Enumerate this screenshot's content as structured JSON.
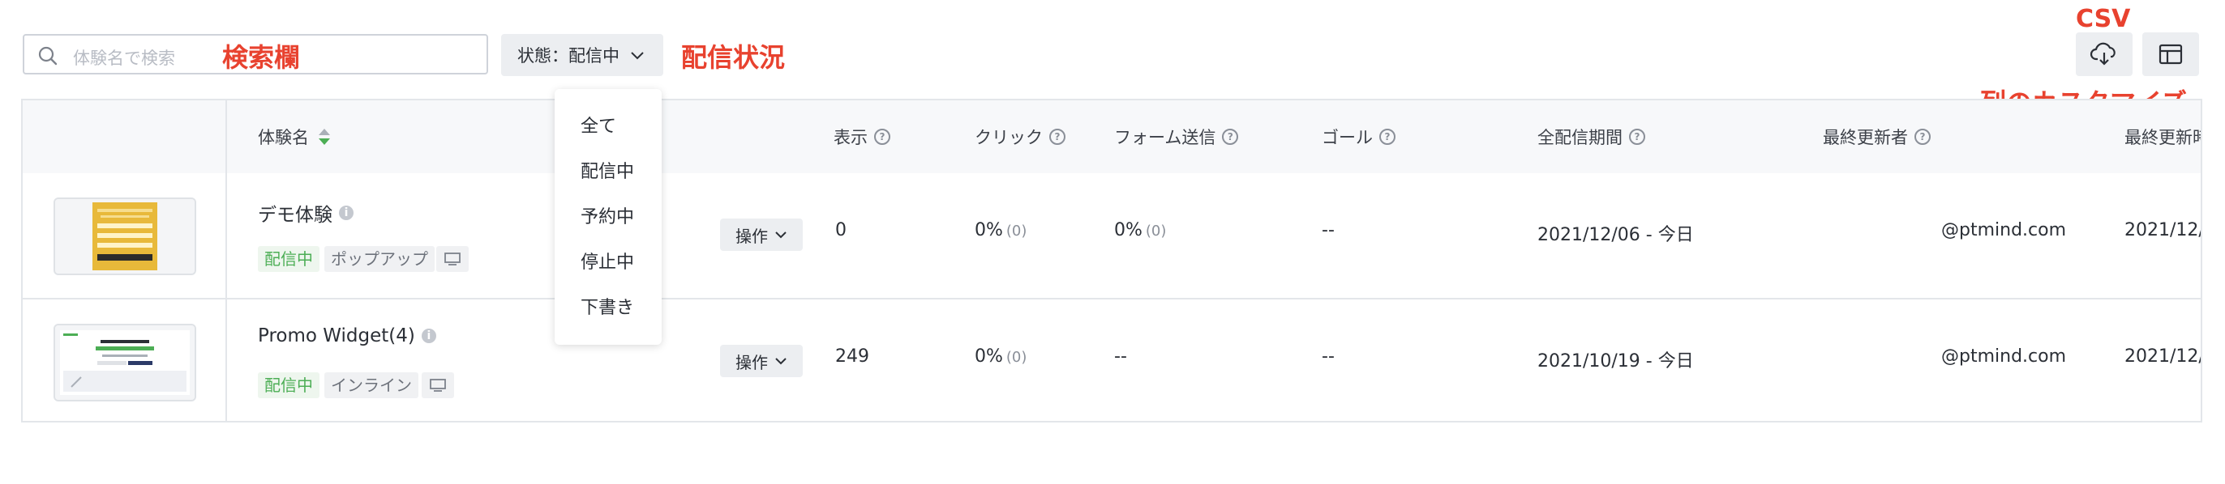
{
  "search": {
    "placeholder": "体験名で検索"
  },
  "annotations": {
    "search": "検索欄",
    "status": "配信状況",
    "csv": "CSV",
    "columns": "列のカスタマイズ"
  },
  "status_filter": {
    "label": "状態：",
    "value": "配信中"
  },
  "status_options": [
    "全て",
    "配信中",
    "予約中",
    "停止中",
    "下書き"
  ],
  "table": {
    "headers": {
      "name": "体験名",
      "impressions": "表示",
      "clicks": "クリック",
      "form": "フォーム送信",
      "goal": "ゴール",
      "period": "全配信期間",
      "updater": "最終更新者",
      "updated": "最終更新時"
    },
    "rows": [
      {
        "name": "デモ体験",
        "status": "配信中",
        "type": "ポップアップ",
        "op": "操作",
        "impressions": "0",
        "clicks": "0%",
        "clicks_count": "(0)",
        "form": "0%",
        "form_count": "(0)",
        "goal": "--",
        "period": "2021/12/06 - 今日",
        "updater": "@ptmind.com",
        "updated": "2021/12/"
      },
      {
        "name": "Promo Widget(4)",
        "status": "配信中",
        "type": "インライン",
        "op": "操作",
        "impressions": "249",
        "clicks": "0%",
        "clicks_count": "(0)",
        "form": "--",
        "goal": "--",
        "period": "2021/10/19 - 今日",
        "updater": "@ptmind.com",
        "updated": "2021/12/"
      }
    ]
  },
  "colors": {
    "annotation": "#e8422f",
    "status_green": "#4cae55",
    "sort_green": "#4cae55"
  },
  "icons": {
    "search": "search-icon",
    "csv": "cloud-download-icon",
    "columns": "layout-icon",
    "device": "desktop-icon"
  }
}
